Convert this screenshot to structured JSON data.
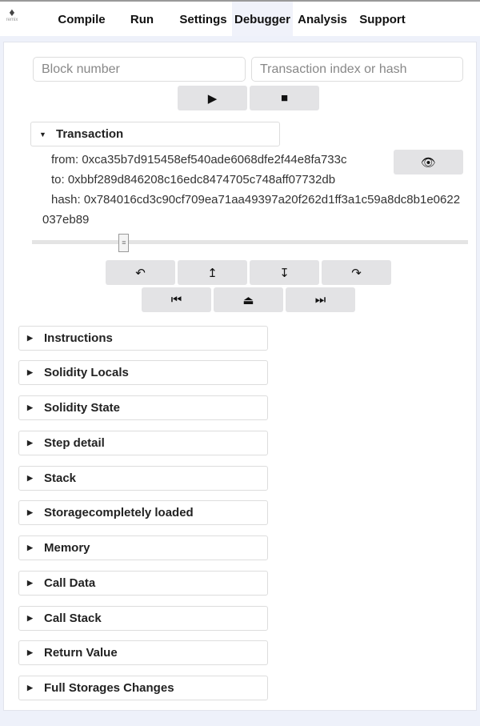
{
  "nav": {
    "logo_text": "remix",
    "tabs": [
      "Compile",
      "Run",
      "Settings",
      "Debugger",
      "Analysis",
      "Support"
    ],
    "active": "Debugger"
  },
  "inputs": {
    "block_placeholder": "Block number",
    "tx_placeholder": "Transaction index or hash"
  },
  "controls": {
    "play_icon": "▶",
    "stop_icon": "■"
  },
  "transaction": {
    "title": "Transaction",
    "from": "from: 0xca35b7d915458ef540ade6068dfe2f44e8fa733c",
    "to": "to: 0xbbf289d846208c16edc8474705c748aff07732db",
    "hash_line1": "hash: 0x784016cd3c90cf709ea71aa49397a20f262d1ff3a1c59a8dc8b1e0622",
    "hash_line2": "037eb89"
  },
  "slider": {
    "value_percent": 21
  },
  "step_buttons": {
    "step_over_back": "↶",
    "step_into_back": "↥",
    "step_into_forward": "↧",
    "step_over_forward": "↷",
    "jump_previous_breakpoint": "⏮",
    "jump_out": "⏏",
    "jump_next_breakpoint": "⏭"
  },
  "sections": [
    "Instructions",
    "Solidity Locals",
    "Solidity State",
    "Step detail",
    "Stack",
    "Storagecompletely loaded",
    "Memory",
    "Call Data",
    "Call Stack",
    "Return Value",
    "Full Storages Changes"
  ]
}
